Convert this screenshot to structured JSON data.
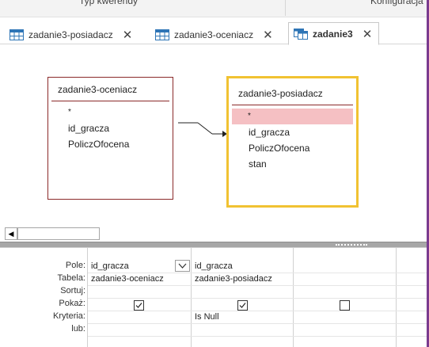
{
  "ribbon": {
    "group_left": "Typ kwerendy",
    "group_right": "Konfiguracja"
  },
  "tabs": [
    {
      "label": "zadanie3-posiadacz",
      "close": "✕",
      "active": false
    },
    {
      "label": "zadanie3-oceniacz",
      "close": "✕",
      "active": false
    },
    {
      "label": "zadanie3",
      "close": "✕",
      "active": true
    }
  ],
  "design_tables": [
    {
      "name": "zadanie3-oceniacz",
      "fields": [
        "*",
        "id_gracza",
        "PoliczOfocena"
      ]
    },
    {
      "name": "zadanie3-posiadacz",
      "fields": [
        "*",
        "id_gracza",
        "PoliczOfocena",
        "stan"
      ],
      "selected_field": "*"
    }
  ],
  "scrollbar": {
    "left_arrow": "◀"
  },
  "grid": {
    "row_labels": [
      "Pole:",
      "Tabela:",
      "Sortuj:",
      "Pokaż:",
      "Kryteria:",
      "lub:"
    ],
    "columns": [
      {
        "field": "id_gracza",
        "table": "zadanie3-oceniacz",
        "sort": "",
        "show": true,
        "criteria": "",
        "or": ""
      },
      {
        "field": "id_gracza",
        "table": "zadanie3-posiadacz",
        "sort": "",
        "show": true,
        "criteria": "Is Null",
        "or": ""
      },
      {
        "field": "",
        "table": "",
        "sort": "",
        "show": false,
        "criteria": "",
        "or": ""
      }
    ]
  },
  "colors": {
    "accent_purple": "#7a3b8f",
    "table_border": "#8b2a2a",
    "selected_table_border": "#f1c232",
    "selected_field": "#f5c0c3"
  }
}
